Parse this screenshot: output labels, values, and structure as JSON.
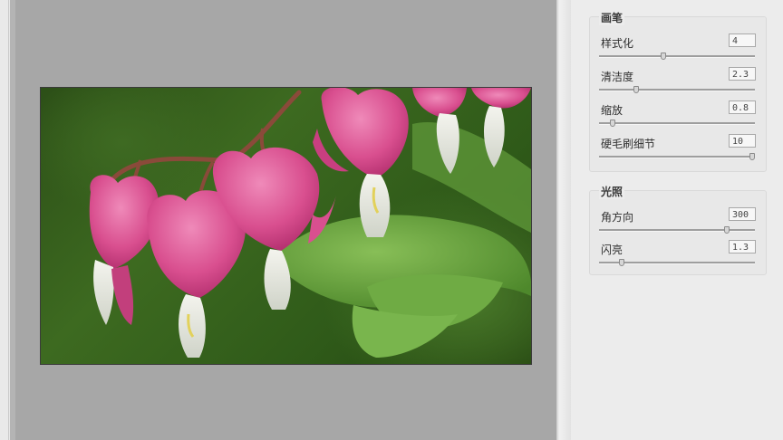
{
  "brush": {
    "title": "画笔",
    "items": [
      {
        "label": "样式化",
        "value": "4",
        "fraction": 0.41
      },
      {
        "label": "清洁度",
        "value": "2.3",
        "fraction": 0.23
      },
      {
        "label": "缩放",
        "value": "0.8",
        "fraction": 0.07
      },
      {
        "label": "硬毛刷细节",
        "value": "10",
        "fraction": 1.0
      }
    ]
  },
  "lighting": {
    "title": "光照",
    "items": [
      {
        "label": "角方向",
        "value": "300",
        "fraction": 0.83
      },
      {
        "label": "闪亮",
        "value": "1.3",
        "fraction": 0.13
      }
    ]
  },
  "colors": {
    "canvas": "#a7a7a7",
    "panel": "#ececec",
    "petal": "#d94f8f",
    "leaf": "#5e9b3a"
  }
}
